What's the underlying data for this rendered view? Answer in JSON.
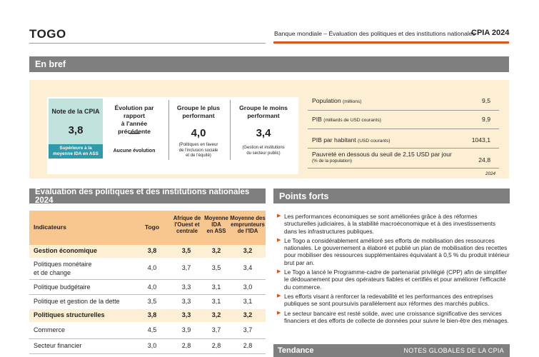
{
  "header": {
    "country": "TOGO",
    "org": "Banque mondiale – Évaluation des politiques et des institutions nationales",
    "cpia": "CPIA 2024"
  },
  "en_bref": {
    "title": "En bref",
    "cpia_title": "Note de la CPIA",
    "cpia_score": "3,8",
    "cpia_badge_1": "Supérieure à la",
    "cpia_badge_2": "moyenne IDA en ASS",
    "evolution_title_1": "Évolution par rapport",
    "evolution_title_2": "à l'année précédente",
    "evolution_value": "—",
    "evolution_sub": "Aucune évolution",
    "best_title_1": "Groupe le plus",
    "best_title_2": "performant",
    "best_value": "4,0",
    "best_sub_1": "(Politiques en faveur",
    "best_sub_2": "de l'inclusion sociale",
    "best_sub_3": "et de l'équité)",
    "worst_title_1": "Groupe le moins",
    "worst_title_2": "performant",
    "worst_value": "3,4",
    "worst_sub_1": "(Gestion et institutions",
    "worst_sub_2": "du secteur public)",
    "stats": [
      {
        "label": "Population",
        "unit": "(millions)",
        "value": "9,5"
      },
      {
        "label": "PIB",
        "unit": "(milliards de USD courants)",
        "value": "9,9"
      },
      {
        "label": "PIB par habitant",
        "unit": "(USD courants)",
        "value": "1043,1"
      },
      {
        "label": "Pauvreté en dessous du seuil de 2,15 USD par jour",
        "unit": "(% de la population)",
        "value": "24,8"
      }
    ],
    "year": "2024"
  },
  "table": {
    "title": "Évaluation des politiques et des institutions nationales 2024",
    "headers": {
      "indicators": "Indicateurs",
      "togo": "Togo",
      "afrique_1": "Afrique de",
      "afrique_2": "l'Ouest et",
      "afrique_3": "centrale",
      "ida_1": "Moyenne",
      "ida_2": "IDA",
      "ida_3": "en ASS",
      "emp_1": "Moyenne des",
      "emp_2": "emprunteurs",
      "emp_3": "de l'IDA"
    },
    "rows": [
      {
        "label": "Gestion économique",
        "label2": "",
        "togo": "3,8",
        "ao": "3,5",
        "ida": "3,2",
        "emp": "3,2",
        "hl": true
      },
      {
        "label": "Politiques monétaire",
        "label2": "et de change",
        "togo": "4,0",
        "ao": "3,7",
        "ida": "3,5",
        "emp": "3,4",
        "hl": false
      },
      {
        "label": "Politique budgétaire",
        "label2": "",
        "togo": "4,0",
        "ao": "3,3",
        "ida": "3,1",
        "emp": "3,0",
        "hl": false
      },
      {
        "label": "Politique et gestion de la dette",
        "label2": "",
        "togo": "3,5",
        "ao": "3,3",
        "ida": "3,1",
        "emp": "3,1",
        "hl": false
      },
      {
        "label": "Politiques structurelles",
        "label2": "",
        "togo": "3,8",
        "ao": "3,3",
        "ida": "3,2",
        "emp": "3,2",
        "hl": true
      },
      {
        "label": "Commerce",
        "label2": "",
        "togo": "4,5",
        "ao": "3,9",
        "ida": "3,7",
        "emp": "3,7",
        "hl": false
      },
      {
        "label": "Secteur financier",
        "label2": "",
        "togo": "3,0",
        "ao": "2,8",
        "ida": "2,8",
        "emp": "2,8",
        "hl": false
      }
    ]
  },
  "points_forts": {
    "title": "Points forts",
    "items": [
      "Les performances économiques se sont améliorées grâce à des réformes structurelles judiciaires, à la stabilité macroéconomique et à des investissements dans les infrastructures publiques.",
      "Le Togo a considérablement amélioré ses efforts de mobilisation des ressources nationales. Le gouvernement a élaboré et publié un plan de mobilisation des recettes pour mobiliser des ressources supplémentaires équivalant à 0,5 % du produit intérieur brut par an.",
      "Le Togo a lancé le Programme-cadre de partenariat privilégié (CPP) afin de simplifier le dédouanement pour des opérateurs fiables et certifiés et pour améliorer l'efficacité du commerce.",
      "Les efforts visant à renforcer la redevabilité et les performances des entreprises publiques se sont poursuivis parallèlement aux réformes des marchés publics.",
      "Le secteur bancaire est resté solide, avec une croissance significative des services financiers et des efforts de collecte de données pour suivre le bien-être des ménages."
    ]
  },
  "tendance": {
    "title": "Tendance",
    "right": "NOTES GLOBALES DE LA CPIA"
  },
  "icons": {
    "bullet": "triangle-right-icon"
  },
  "colors": {
    "accent": "#d9541e",
    "teal": "#2e9aaa",
    "mint": "#bfe3dc",
    "cream": "#fdefd3",
    "peach": "#f8c68f",
    "bar": "#7f7f7f"
  }
}
